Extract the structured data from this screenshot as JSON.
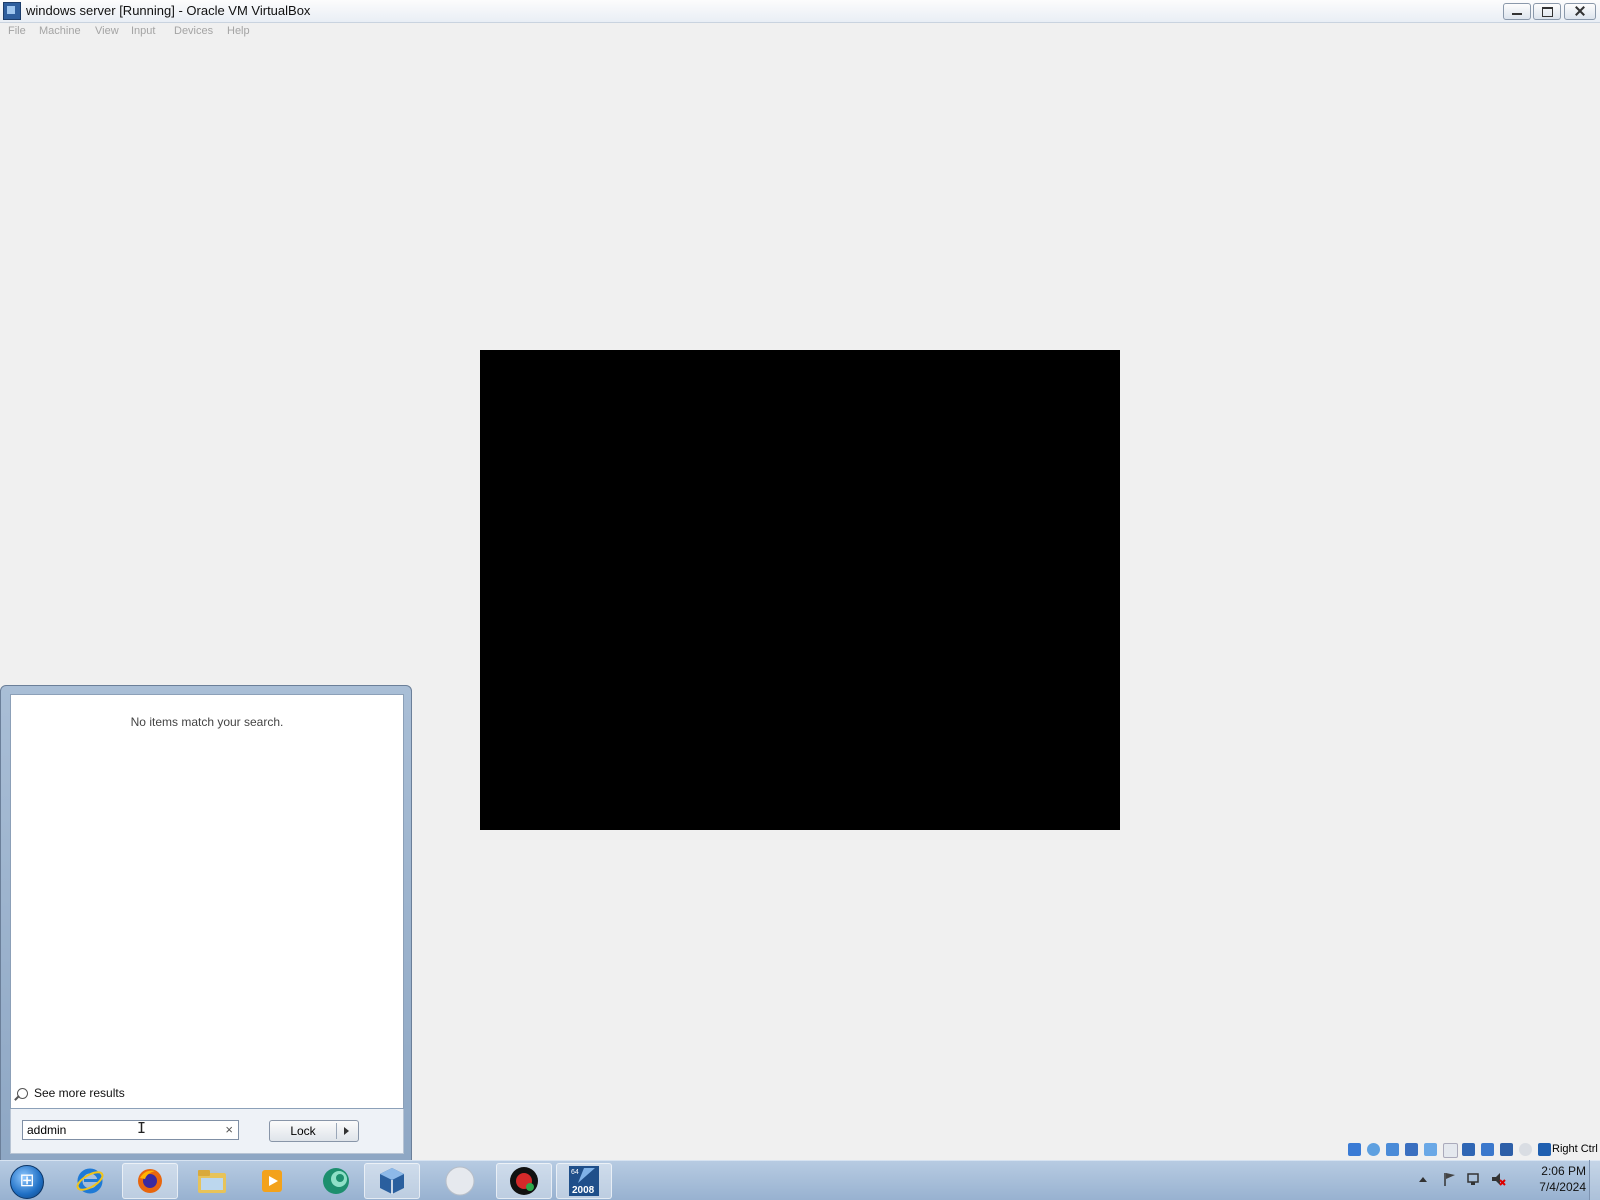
{
  "window": {
    "title": "windows server [Running] - Oracle VM VirtualBox"
  },
  "menu": {
    "items": [
      "File",
      "Machine",
      "View",
      "Input",
      "Devices",
      "Help"
    ]
  },
  "start_menu": {
    "no_items_text": "No items match your search.",
    "see_more_label": "See more results",
    "search_value": "addmin",
    "lock_label": "Lock"
  },
  "status_bar": {
    "host_key_label": "Right Ctrl"
  },
  "taskbar": {
    "apps": [
      "internet-explorer-icon",
      "firefox-icon",
      "file-explorer-icon",
      "media-player-icon",
      "app-icon",
      "virtualbox-icon",
      "blank-app-icon",
      "recorder-icon",
      "windows-server-2008-icon"
    ],
    "server_badge": "2008",
    "server_badge_small": "64"
  },
  "clock": {
    "time": "2:06 PM",
    "date": "7/4/2024"
  }
}
